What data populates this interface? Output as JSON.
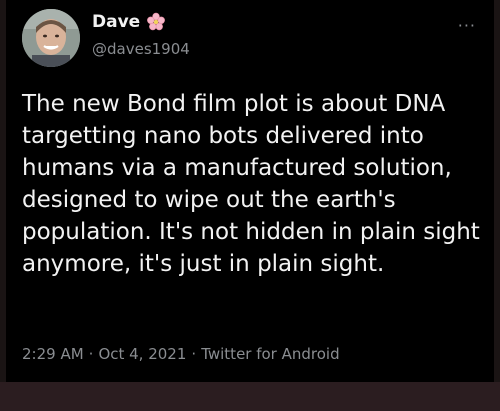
{
  "tweet": {
    "display_name": "Dave",
    "handle": "@daves1904",
    "name_emoji_icon": "cherry-blossom-icon",
    "more_icon": "more-options-icon",
    "more_symbol": "···",
    "text": "The new Bond film plot is about DNA targetting nano bots delivered into humans via a manufactured solution, designed to wipe out the earth's population. It's not hidden in plain sight anymore, it's just in plain sight.",
    "time": "2:29 AM",
    "date": "Oct 4, 2021",
    "source": "Twitter for Android",
    "separator": "·"
  },
  "colors": {
    "background": "#000000",
    "primary_text": "#f2f2f2",
    "secondary_text": "#8a8d91",
    "bottom_bar": "#2b1d20"
  }
}
